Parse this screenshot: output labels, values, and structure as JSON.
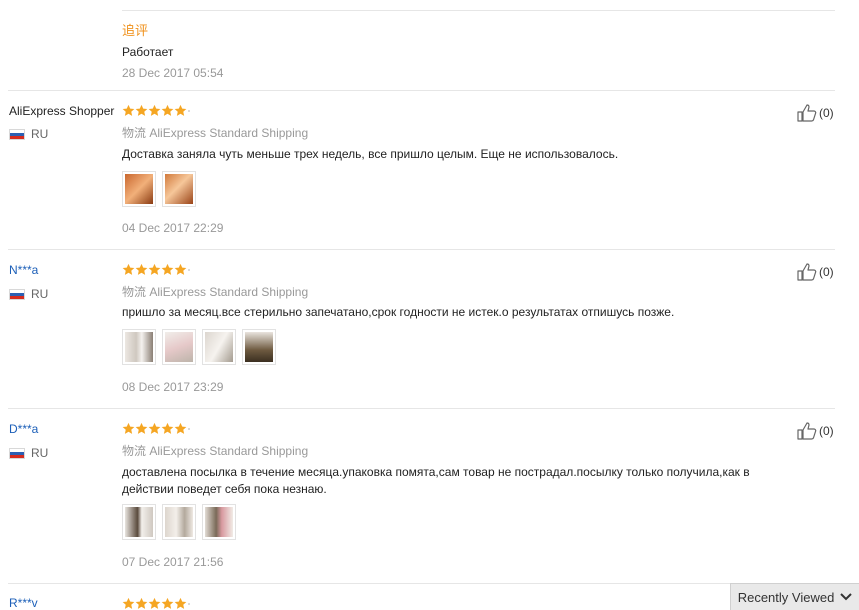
{
  "followup": {
    "title": "追评",
    "text": "Работает",
    "date": "28 Dec 2017 05:54"
  },
  "reviews": [
    {
      "user": "AliExpress Shopper",
      "country": "RU",
      "stars": 5,
      "shipping_label": "物流",
      "shipping_method": "AliExpress Standard Shipping",
      "text": "Доставка заняла чуть меньше трех недель, все пришло целым. Еще не использовалось.",
      "photos": [
        "photo-1",
        "photo-2"
      ],
      "date": "04 Dec 2017 22:29",
      "helpful": "(0)"
    },
    {
      "user": "N***a",
      "country": "RU",
      "stars": 5,
      "shipping_label": "物流",
      "shipping_method": "AliExpress Standard Shipping",
      "text": "пришло за месяц.все стерильно запечатано,срок годности не истек.о результатах отпишусь позже.",
      "photos": [
        "photo-1",
        "photo-2",
        "photo-3",
        "photo-4"
      ],
      "date": "08 Dec 2017 23:29",
      "helpful": "(0)"
    },
    {
      "user": "D***a",
      "country": "RU",
      "stars": 5,
      "shipping_label": "物流",
      "shipping_method": "AliExpress Standard Shipping",
      "text": "доставлена посылка в течение месяца.упаковка помята,сам товар не пострадал.посылку только получила,как в действии поведет себя пока незнаю.",
      "photos": [
        "photo-1",
        "photo-2",
        "photo-3"
      ],
      "date": "07 Dec 2017 21:56",
      "helpful": "(0)"
    },
    {
      "user": "R***v",
      "stars": 5
    }
  ],
  "recently_viewed": {
    "label": "Recently Viewed",
    "icon": "chevron-down-icon"
  },
  "colors": {
    "star": "#f5a623",
    "link": "#1c5fb8",
    "accent": "#f0911b"
  }
}
